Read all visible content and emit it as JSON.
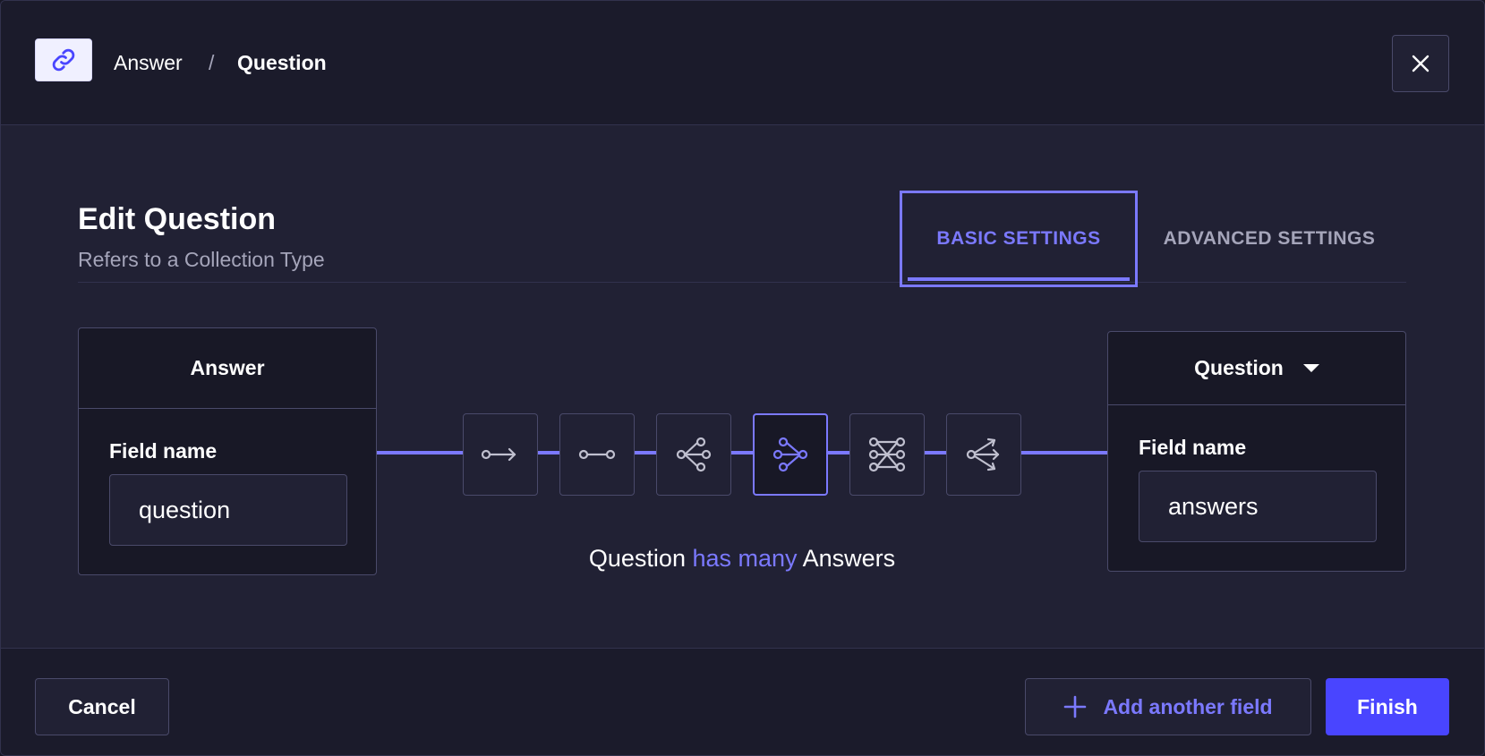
{
  "header": {
    "breadcrumb_parent": "Answer",
    "breadcrumb_separator": "/",
    "breadcrumb_current": "Question",
    "link_icon": "link-icon",
    "close_icon": "close-icon"
  },
  "main": {
    "title": "Edit Question",
    "subtitle": "Refers to a Collection Type",
    "tabs": [
      {
        "label": "BASIC SETTINGS",
        "active": true
      },
      {
        "label": "ADVANCED SETTINGS",
        "active": false
      }
    ]
  },
  "left_box": {
    "header": "Answer",
    "field_label": "Field name",
    "field_value": "question"
  },
  "right_box": {
    "header": "Question",
    "field_label": "Field name",
    "field_value": "answers",
    "dropdown_icon": "caret-down-icon"
  },
  "relations": {
    "options": [
      {
        "name": "one-way",
        "icon": "one-way-icon"
      },
      {
        "name": "one-to-one",
        "icon": "one-to-one-icon"
      },
      {
        "name": "one-to-many",
        "icon": "one-to-many-icon"
      },
      {
        "name": "many-to-one",
        "icon": "many-to-one-icon",
        "active": true
      },
      {
        "name": "many-to-many",
        "icon": "many-to-many-icon"
      },
      {
        "name": "many-way",
        "icon": "many-way-icon"
      }
    ],
    "description_subject": "Question",
    "description_relation": "has many",
    "description_object": "Answers"
  },
  "footer": {
    "cancel_label": "Cancel",
    "add_field_label": "Add another field",
    "finish_label": "Finish"
  },
  "colors": {
    "accent": "#7b79ff",
    "primary": "#4945ff",
    "background": "#212134",
    "surface": "#181826"
  }
}
